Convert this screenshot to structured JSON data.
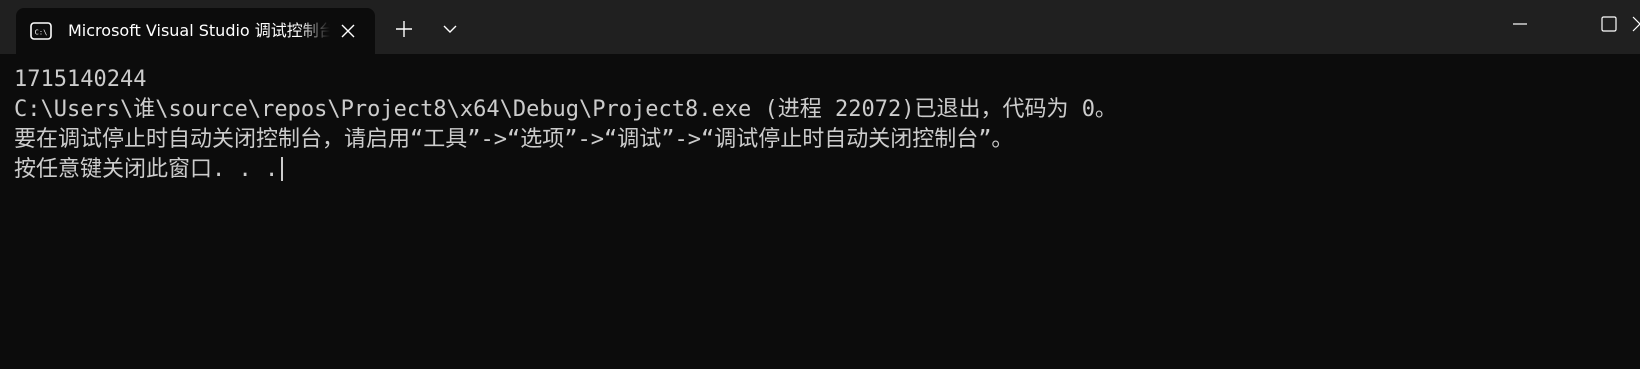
{
  "titlebar": {
    "tab": {
      "title": "Microsoft Visual Studio 调试控制台",
      "icon": "console-icon",
      "close_icon": "close-icon"
    },
    "new_tab_icon": "plus-icon",
    "dropdown_icon": "chevron-down-icon",
    "window_controls": {
      "minimize_icon": "minimize-icon",
      "maximize_icon": "maximize-icon",
      "close_icon": "close-icon"
    }
  },
  "console": {
    "lines": [
      "1715140244",
      "C:\\Users\\谁\\source\\repos\\Project8\\x64\\Debug\\Project8.exe (进程 22072)已退出，代码为 0。",
      "要在调试停止时自动关闭控制台，请启用“工具”->“选项”->“调试”->“调试停止时自动关闭控制台”。",
      "按任意键关闭此窗口. . ."
    ]
  },
  "colors": {
    "titlebar_bg": "#202020",
    "console_bg": "#0c0c0c",
    "console_text": "#cccccc",
    "tab_text": "#ffffff"
  }
}
